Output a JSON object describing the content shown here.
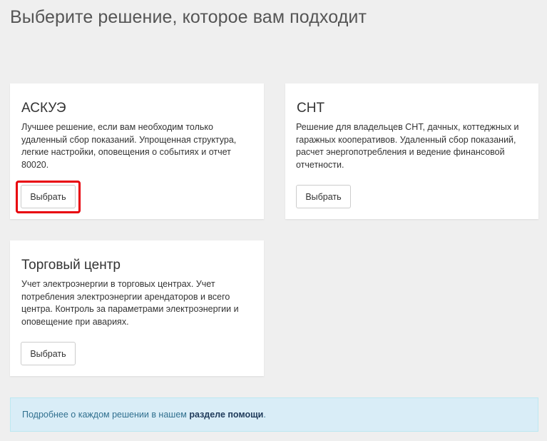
{
  "page_title": "Выберите решение, которое вам подходит",
  "cards": [
    {
      "title": "АСКУЭ",
      "description": [
        "Лучшее решение, если вам необходим только",
        "удаленный сбор показаний. Упрощенная структура,",
        "легкие настройки, оповещения о событиях и отчет",
        "80020."
      ],
      "button_label": "Выбрать"
    },
    {
      "title": "СНТ",
      "description": [
        "Решение для владельцев СНТ, дачных, коттеджных и",
        "гаражных кооперативов. Удаленный сбор показаний,",
        "расчет энергопотребления и ведение финансовой",
        "отчетности."
      ],
      "button_label": "Выбрать"
    },
    {
      "title": "Торговый центр",
      "description": [
        "Учет электроэнергии в торговых центрах. Учет",
        "потребления электроэнергии арендаторов и всего",
        "центра. Контроль за параметрами электроэнергии и",
        "оповещение при авариях."
      ],
      "button_label": "Выбрать"
    }
  ],
  "info": {
    "text": "Подробнее о каждом решении в нашем ",
    "link_text": "разделе помощи",
    "suffix": "."
  },
  "colors": {
    "highlight": "#e8000b",
    "info_bg": "#d9edf7",
    "info_text": "#31708f"
  }
}
